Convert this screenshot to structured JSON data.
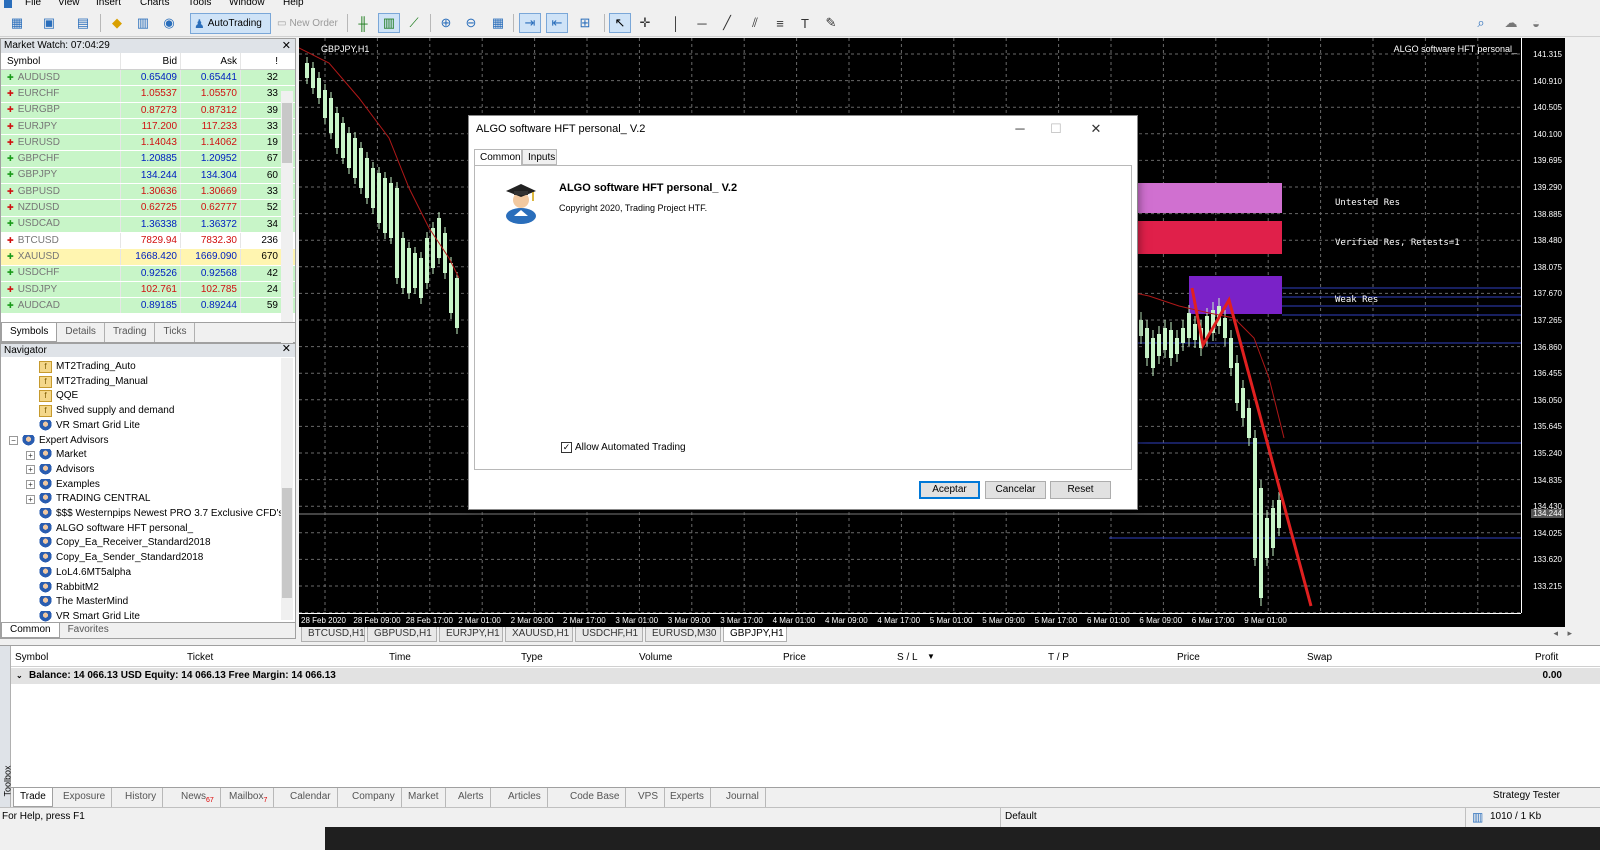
{
  "menu": [
    "File",
    "View",
    "Insert",
    "Charts",
    "Tools",
    "Window",
    "Help"
  ],
  "toolbar": {
    "autotrading": "AutoTrading",
    "new_order": "New Order"
  },
  "market_watch": {
    "title": "Market Watch: 07:04:29",
    "headers": [
      "Symbol",
      "Bid",
      "Ask",
      "!"
    ],
    "rows": [
      {
        "symbol": "AUDUSD",
        "bid": "0.65409",
        "ask": "0.65441",
        "spread": "32",
        "dir": "up",
        "bg": "#c8f5c8"
      },
      {
        "symbol": "EURCHF",
        "bid": "1.05537",
        "ask": "1.05570",
        "spread": "33",
        "dir": "down",
        "bg": "#c8f5c8"
      },
      {
        "symbol": "EURGBP",
        "bid": "0.87273",
        "ask": "0.87312",
        "spread": "39",
        "dir": "down",
        "bg": "#c8f5c8"
      },
      {
        "symbol": "EURJPY",
        "bid": "117.200",
        "ask": "117.233",
        "spread": "33",
        "dir": "down",
        "bg": "#c8f5c8"
      },
      {
        "symbol": "EURUSD",
        "bid": "1.14043",
        "ask": "1.14062",
        "spread": "19",
        "dir": "down",
        "bg": "#c8f5c8"
      },
      {
        "symbol": "GBPCHF",
        "bid": "1.20885",
        "ask": "1.20952",
        "spread": "67",
        "dir": "up",
        "bg": "#c8f5c8"
      },
      {
        "symbol": "GBPJPY",
        "bid": "134.244",
        "ask": "134.304",
        "spread": "60",
        "dir": "up",
        "bg": "#c8f5c8"
      },
      {
        "symbol": "GBPUSD",
        "bid": "1.30636",
        "ask": "1.30669",
        "spread": "33",
        "dir": "down",
        "bg": "#c8f5c8"
      },
      {
        "symbol": "NZDUSD",
        "bid": "0.62725",
        "ask": "0.62777",
        "spread": "52",
        "dir": "down",
        "bg": "#c8f5c8"
      },
      {
        "symbol": "USDCAD",
        "bid": "1.36338",
        "ask": "1.36372",
        "spread": "34",
        "dir": "up",
        "bg": "#c8f5c8"
      },
      {
        "symbol": "BTCUSD",
        "bid": "7829.94",
        "ask": "7832.30",
        "spread": "236",
        "dir": "down",
        "bg": "#ffffff"
      },
      {
        "symbol": "XAUUSD",
        "bid": "1668.420",
        "ask": "1669.090",
        "spread": "670",
        "dir": "up",
        "bg": "#fff5b0"
      },
      {
        "symbol": "USDCHF",
        "bid": "0.92526",
        "ask": "0.92568",
        "spread": "42",
        "dir": "up",
        "bg": "#c8f5c8"
      },
      {
        "symbol": "USDJPY",
        "bid": "102.761",
        "ask": "102.785",
        "spread": "24",
        "dir": "down",
        "bg": "#c8f5c8"
      },
      {
        "symbol": "AUDCAD",
        "bid": "0.89185",
        "ask": "0.89244",
        "spread": "59",
        "dir": "up",
        "bg": "#c8f5c8"
      }
    ],
    "tabs": [
      "Symbols",
      "Details",
      "Trading",
      "Ticks"
    ]
  },
  "navigator": {
    "title": "Navigator",
    "items": [
      {
        "label": "MT2Trading_Auto",
        "type": "indicator",
        "indent": 2
      },
      {
        "label": "MT2Trading_Manual",
        "type": "indicator",
        "indent": 2
      },
      {
        "label": "QQE",
        "type": "indicator",
        "indent": 2
      },
      {
        "label": "Shved supply and demand",
        "type": "indicator",
        "indent": 2
      },
      {
        "label": "VR Smart Grid Lite",
        "type": "ea",
        "indent": 2
      },
      {
        "label": "Expert Advisors",
        "type": "folder",
        "indent": 1
      },
      {
        "label": "Market",
        "type": "folder",
        "indent": 2
      },
      {
        "label": "Advisors",
        "type": "folder",
        "indent": 2
      },
      {
        "label": "Examples",
        "type": "folder",
        "indent": 2
      },
      {
        "label": "TRADING CENTRAL",
        "type": "folder",
        "indent": 2
      },
      {
        "label": "$$$ Westernpips Newest PRO 3.7 Exclusive CFD's",
        "type": "ea",
        "indent": 2
      },
      {
        "label": "ALGO software HFT personal_",
        "type": "ea",
        "indent": 2
      },
      {
        "label": "Copy_Ea_Receiver_Standard2018",
        "type": "ea",
        "indent": 2
      },
      {
        "label": "Copy_Ea_Sender_Standard2018",
        "type": "ea",
        "indent": 2
      },
      {
        "label": "LoL4.6MT5alpha",
        "type": "ea",
        "indent": 2
      },
      {
        "label": "RabbitM2",
        "type": "ea",
        "indent": 2
      },
      {
        "label": "The MasterMind",
        "type": "ea",
        "indent": 2
      },
      {
        "label": "VR Smart Grid Lite",
        "type": "ea",
        "indent": 2
      }
    ],
    "tabs": [
      "Common",
      "Favorites"
    ]
  },
  "chart": {
    "symbol_label": "GBPJPY,H1",
    "ea_label": "ALGO software HFT personal_",
    "current_price": "134.244",
    "zones": [
      {
        "label": "Untested Res",
        "color": "#d070d0"
      },
      {
        "label": "Verified Res, Retests=1",
        "color": "#e0204a"
      },
      {
        "label": "Weak Res",
        "color": "#7a22c8"
      }
    ],
    "price_ticks": [
      "141.315",
      "140.910",
      "140.505",
      "140.100",
      "139.695",
      "139.290",
      "138.885",
      "138.480",
      "138.075",
      "137.670",
      "137.265",
      "136.860",
      "136.455",
      "136.050",
      "135.645",
      "135.240",
      "134.835",
      "134.430",
      "134.025",
      "133.620",
      "133.215"
    ],
    "time_ticks": [
      "28 Feb 2020",
      "28 Feb 09:00",
      "28 Feb 17:00",
      "2 Mar 01:00",
      "2 Mar 09:00",
      "2 Mar 17:00",
      "3 Mar 01:00",
      "3 Mar 09:00",
      "3 Mar 17:00",
      "4 Mar 01:00",
      "4 Mar 09:00",
      "4 Mar 17:00",
      "5 Mar 01:00",
      "5 Mar 09:00",
      "5 Mar 17:00",
      "6 Mar 01:00",
      "6 Mar 09:00",
      "6 Mar 17:00",
      "9 Mar 01:00"
    ],
    "tabs": [
      "BTCUSD,H1",
      "GBPUSD,H1",
      "EURJPY,H1",
      "XAUUSD,H1",
      "USDCHF,H1",
      "EURUSD,M30",
      "GBPJPY,H1"
    ]
  },
  "terminal": {
    "side_label": "Toolbox",
    "headers": [
      "Symbol",
      "Ticket",
      "Time",
      "Type",
      "Volume",
      "Price",
      "S / L",
      "T / P",
      "Price",
      "Swap",
      "Profit"
    ],
    "balance": "Balance: 14 066.13 USD  Equity: 14 066.13  Free Margin: 14 066.13",
    "profit": "0.00",
    "tabs": [
      {
        "label": "Trade",
        "badge": ""
      },
      {
        "label": "Exposure",
        "badge": ""
      },
      {
        "label": "History",
        "badge": ""
      },
      {
        "label": "News",
        "badge": "67"
      },
      {
        "label": "Mailbox",
        "badge": "7"
      },
      {
        "label": "Calendar",
        "badge": ""
      },
      {
        "label": "Company",
        "badge": ""
      },
      {
        "label": "Market",
        "badge": ""
      },
      {
        "label": "Alerts",
        "badge": ""
      },
      {
        "label": "Articles",
        "badge": ""
      },
      {
        "label": "Code Base",
        "badge": ""
      },
      {
        "label": "VPS",
        "badge": ""
      },
      {
        "label": "Experts",
        "badge": ""
      },
      {
        "label": "Journal",
        "badge": ""
      }
    ],
    "strategy_tester": "Strategy Tester"
  },
  "status": {
    "help": "For Help, press F1",
    "profile": "Default",
    "traffic": "1010 / 1 Kb"
  },
  "dialog": {
    "title": "ALGO software HFT personal_ V.2",
    "tabs": [
      "Common",
      "Inputs"
    ],
    "name": "ALGO software HFT personal_ V.2",
    "copyright": "Copyright 2020, Trading Project HTF.",
    "checkbox": "Allow Automated Trading",
    "checked": true,
    "buttons": [
      "Aceptar",
      "Cancelar",
      "Reset"
    ]
  }
}
